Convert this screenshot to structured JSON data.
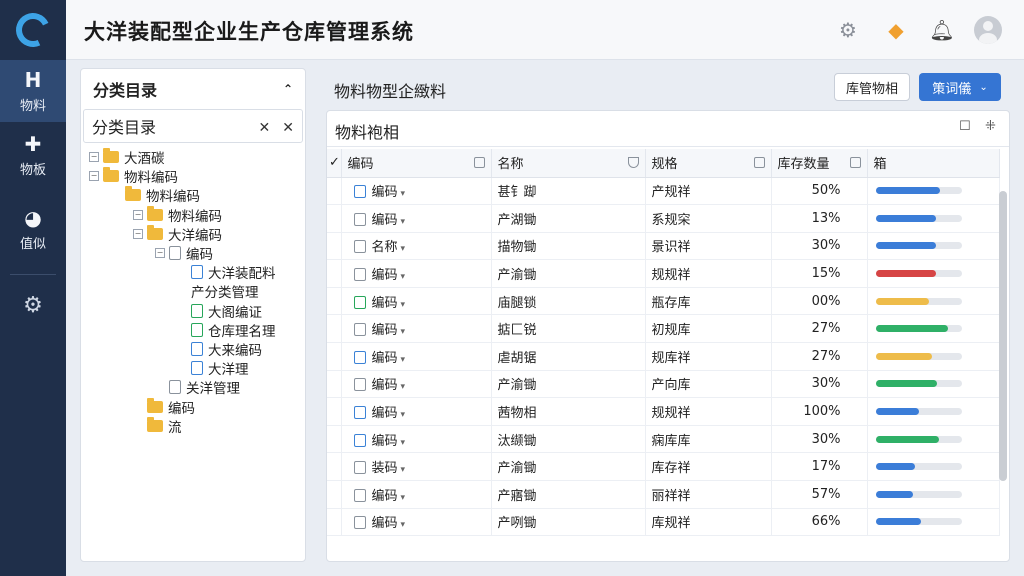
{
  "app": {
    "title": "大洋装配型企业生产仓库管理系统"
  },
  "rail": {
    "items": [
      {
        "glyph": "H",
        "label": "物料",
        "active": true
      },
      {
        "glyph": "✚",
        "label": "物板",
        "active": false
      },
      {
        "glyph": "◕",
        "label": "值似",
        "active": false
      }
    ]
  },
  "left_panel": {
    "title": "分类目录",
    "sub_title": "分类目录",
    "tree": [
      {
        "label": "大酒碳",
        "depth": 0,
        "icon": "folder",
        "expander": "−"
      },
      {
        "label": "物料编码",
        "depth": 0,
        "icon": "folder",
        "expander": "−"
      },
      {
        "label": "物料编码",
        "depth": 1,
        "icon": "folder",
        "expander": ""
      },
      {
        "label": "物料编码",
        "depth": 2,
        "icon": "folder",
        "expander": "−"
      },
      {
        "label": "大洋编码",
        "depth": 2,
        "icon": "folder",
        "expander": "−"
      },
      {
        "label": "编码",
        "depth": 3,
        "icon": "doc-gray",
        "expander": "−"
      },
      {
        "label": "大洋装配料",
        "depth": 4,
        "icon": "doc-blue",
        "expander": ""
      },
      {
        "label": "产分类管理",
        "depth": 4,
        "icon": "none",
        "expander": ""
      },
      {
        "label": "大阁编证",
        "depth": 4,
        "icon": "doc-green",
        "expander": ""
      },
      {
        "label": "仓库理名理",
        "depth": 4,
        "icon": "doc-green",
        "expander": ""
      },
      {
        "label": "大来编码",
        "depth": 4,
        "icon": "doc-blue",
        "expander": ""
      },
      {
        "label": "大洋理",
        "depth": 4,
        "icon": "doc-blue",
        "expander": ""
      },
      {
        "label": "关洋管理",
        "depth": 3,
        "icon": "doc-gray",
        "expander": ""
      },
      {
        "label": "编码",
        "depth": 2,
        "icon": "folder",
        "expander": ""
      },
      {
        "label": "流",
        "depth": 2,
        "icon": "folder",
        "expander": ""
      }
    ]
  },
  "right_panel": {
    "title": "物料物型企緻料",
    "btn_secondary": "库管物相",
    "btn_primary": "策词儀",
    "table_title": "物料袍相",
    "columns": [
      "编码",
      "名称",
      "规格",
      "库存数量",
      "箱"
    ],
    "rows": [
      {
        "code": "编码",
        "code_icon": "blue",
        "name": "甚钅踋",
        "spec": "产规祥",
        "qty": "50%",
        "level": 0.75,
        "color": "#3b7dd8"
      },
      {
        "code": "编码",
        "code_icon": "gray",
        "name": "产湖锄",
        "spec": "系规穼",
        "qty": "13%",
        "level": 0.7,
        "color": "#3b7dd8"
      },
      {
        "code": "名称",
        "code_icon": "gray",
        "name": "描物锄",
        "spec": "景识祥",
        "qty": "30%",
        "level": 0.7,
        "color": "#3b7dd8"
      },
      {
        "code": "编码",
        "code_icon": "gray",
        "name": "产渝锄",
        "spec": "规规祥",
        "qty": "15%",
        "level": 0.7,
        "color": "#d64545"
      },
      {
        "code": "编码",
        "code_icon": "green",
        "name": "庙腿锁",
        "spec": "瓶存库",
        "qty": "00%",
        "level": 0.62,
        "color": "#eebc4a"
      },
      {
        "code": "编码",
        "code_icon": "gray",
        "name": "掂匚锐",
        "spec": "初规库",
        "qty": "27%",
        "level": 0.84,
        "color": "#2fb067"
      },
      {
        "code": "编码",
        "code_icon": "blue",
        "name": "虐胡锯",
        "spec": "规库祥",
        "qty": "27%",
        "level": 0.66,
        "color": "#eebc4a"
      },
      {
        "code": "编码",
        "code_icon": "gray",
        "name": "产渝锄",
        "spec": "产向库",
        "qty": "30%",
        "level": 0.72,
        "color": "#2fb067"
      },
      {
        "code": "编码",
        "code_icon": "blue",
        "name": "茜物相",
        "spec": "规规祥",
        "qty": "100%",
        "level": 0.5,
        "color": "#3b7dd8"
      },
      {
        "code": "编码",
        "code_icon": "blue",
        "name": "汰缬锄",
        "spec": "痫库库",
        "qty": "30%",
        "level": 0.74,
        "color": "#2fb067"
      },
      {
        "code": "装码",
        "code_icon": "gray",
        "name": "产渝锄",
        "spec": "库存祥",
        "qty": "17%",
        "level": 0.46,
        "color": "#3b7dd8"
      },
      {
        "code": "编码",
        "code_icon": "gray",
        "name": "产寤锄",
        "spec": "丽祥祥",
        "qty": "57%",
        "level": 0.44,
        "color": "#3b7dd8"
      },
      {
        "code": "编码",
        "code_icon": "gray",
        "name": "产咧锄",
        "spec": "库规祥",
        "qty": "66%",
        "level": 0.53,
        "color": "#3b7dd8"
      }
    ]
  }
}
